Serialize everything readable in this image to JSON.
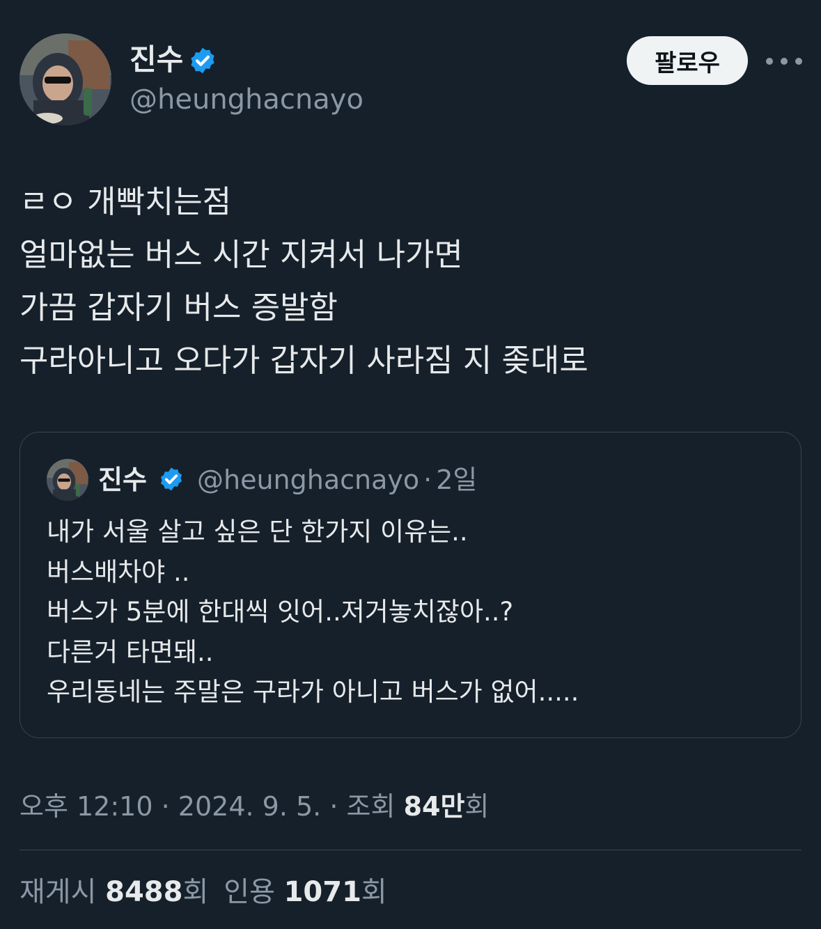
{
  "tweet": {
    "author_name": "진수",
    "author_handle": "@heunghacnayo",
    "follow_label": "팔로우",
    "verified": true,
    "text_lines": [
      "ㄹㅇ 개빡치는점",
      "얼마없는 버스 시간 지켜서 나가면",
      "가끔 갑자기 버스 증발함",
      "구라아니고 오다가 갑자기 사라짐 지 좆대로"
    ]
  },
  "quoted": {
    "author_name": "진수",
    "author_handle": "@heunghacnayo",
    "separator": "·",
    "age": "2일",
    "text_lines": [
      "내가 서울 살고 싶은 단 한가지 이유는..",
      "버스배차야 ..",
      "버스가 5분에 한대씩 잇어..저거놓치잖아..?",
      "다른거 타면돼..",
      "우리동네는 주말은 구라가 아니고 버스가 없어....."
    ]
  },
  "meta": {
    "time": "오후 12:10",
    "date": "2024. 9. 5.",
    "separator": "·",
    "views_label": "조회",
    "views_value": "84만",
    "views_unit": "회"
  },
  "stats": {
    "reposts_label": "재게시",
    "reposts_value": "8488",
    "reposts_unit": "회",
    "quotes_label": "인용",
    "quotes_value": "1071",
    "quotes_unit": "회"
  },
  "icons": {
    "verified": "verified-badge-icon",
    "more": "more-horizontal-icon"
  },
  "colors": {
    "background": "#15202b",
    "primary_text": "#e7e9ea",
    "secondary_text": "#8b98a5",
    "verified_blue": "#1d9bf0",
    "border": "#38444d"
  }
}
